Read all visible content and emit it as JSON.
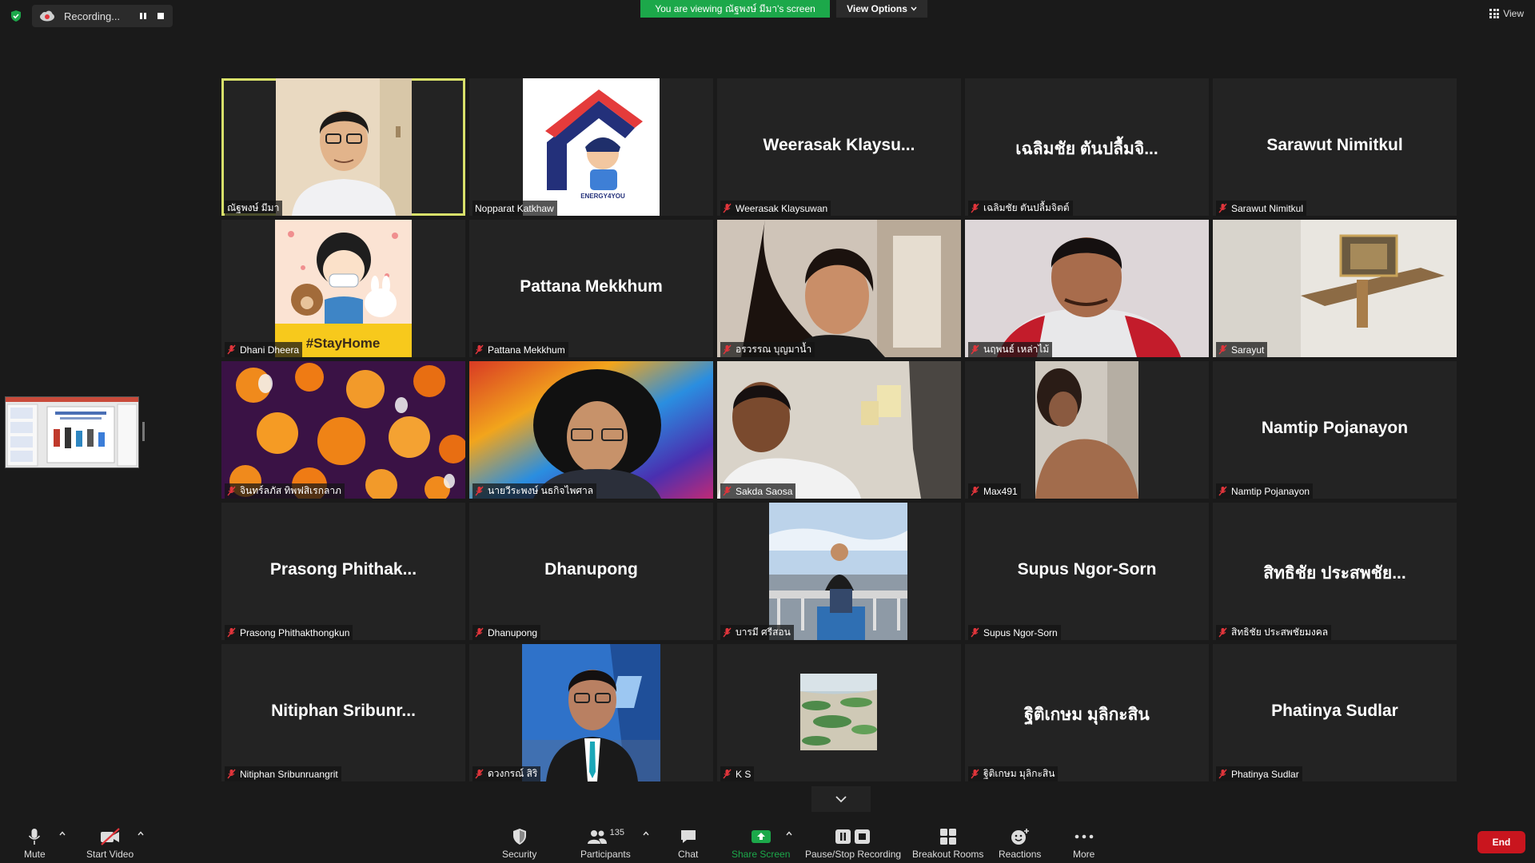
{
  "top": {
    "recording_label": "Recording...",
    "viewing_banner": "You are viewing ณัฐพงษ์ มีมา's screen",
    "view_options_label": "View Options",
    "view_label": "View"
  },
  "tiles": [
    {
      "big": "",
      "label": "ณัฐพงษ์ มีมา",
      "muted": false
    },
    {
      "big": "",
      "label": "Nopparat Katkhaw",
      "muted": false
    },
    {
      "big": "Weerasak  Klaysu...",
      "label": "Weerasak Klaysuwan",
      "muted": true
    },
    {
      "big": "เฉลิมชัย ตันปลื้มจิ...",
      "label": "เฉลิมชัย ตันปลื้มจิตต์",
      "muted": true
    },
    {
      "big": "Sarawut Nimitkul",
      "label": "Sarawut Nimitkul",
      "muted": true
    },
    {
      "big": "",
      "label": "Dhani Dheera",
      "muted": true
    },
    {
      "big": "Pattana Mekkhum",
      "label": "Pattana Mekkhum",
      "muted": true
    },
    {
      "big": "",
      "label": "อรวรรณ บุญมาน้ำ",
      "muted": true
    },
    {
      "big": "",
      "label": "นฤพนธ์ เหล่าไม้",
      "muted": true
    },
    {
      "big": "",
      "label": "Sarayut",
      "muted": true
    },
    {
      "big": "",
      "label": "จินทร์ลภัส ทิพฟสิเรกลาภ",
      "muted": true
    },
    {
      "big": "",
      "label": "นายวีระพงษ์ นธกิจไพศาล",
      "muted": true
    },
    {
      "big": "",
      "label": "Sakda Saosa",
      "muted": true
    },
    {
      "big": "",
      "label": "Max491",
      "muted": true
    },
    {
      "big": "Namtip Pojanayon",
      "label": "Namtip Pojanayon",
      "muted": true
    },
    {
      "big": "Prasong  Phithak...",
      "label": "Prasong Phithakthongkun",
      "muted": true
    },
    {
      "big": "Dhanupong",
      "label": "Dhanupong",
      "muted": true
    },
    {
      "big": "",
      "label": "บารมี ศรีสอน",
      "muted": true
    },
    {
      "big": "Supus Ngor-Sorn",
      "label": "Supus Ngor-Sorn",
      "muted": true
    },
    {
      "big": "สิทธิชัย ประสพชัย...",
      "label": "สิทธิชัย ประสพชัยมงคล",
      "muted": true
    },
    {
      "big": "Nitiphan  Sribunr...",
      "label": "Nitiphan Sribunruangrit",
      "muted": true
    },
    {
      "big": "",
      "label": "ดวงกรณ์ สิริ",
      "muted": true
    },
    {
      "big": "",
      "label": "K S",
      "muted": true
    },
    {
      "big": "ฐิติเกษม มุลิกะสิน",
      "label": "ฐิติเกษม มุลิกะสิน",
      "muted": true
    },
    {
      "big": "Phatinya Sudlar",
      "label": "Phatinya Sudlar",
      "muted": true
    }
  ],
  "avatar_text": {
    "stayhome": "#StayHome",
    "energy_logo": "ENERGY4YOU"
  },
  "toolbar": {
    "mute": "Mute",
    "start_video": "Start Video",
    "security": "Security",
    "participants": "Participants",
    "participant_count": "135",
    "chat": "Chat",
    "share_screen": "Share Screen",
    "pause_stop_recording": "Pause/Stop Recording",
    "breakout_rooms": "Breakout Rooms",
    "reactions": "Reactions",
    "more": "More",
    "end": "End"
  },
  "colors": {
    "banner_green": "#1ca84a",
    "active_speaker": "#d8e06a",
    "end_red": "#c9151e",
    "share_green": "#1ca84a",
    "muted_red": "#e0353b"
  }
}
